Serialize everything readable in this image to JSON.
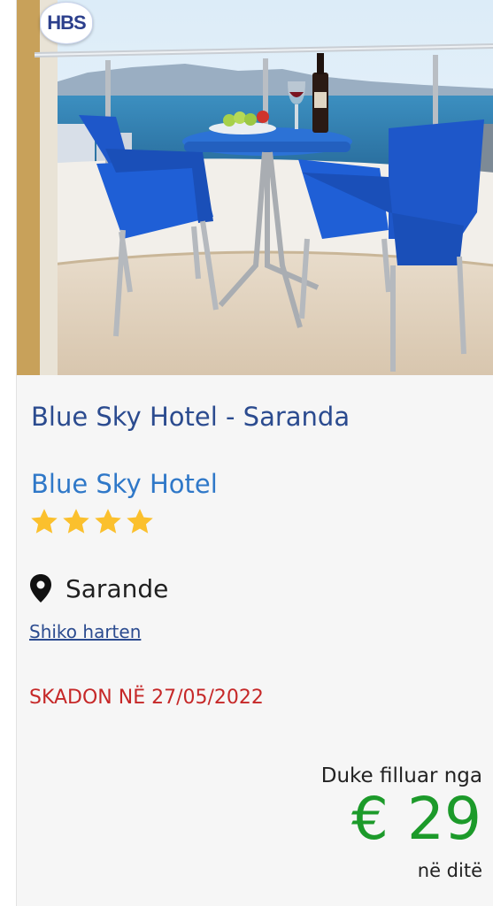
{
  "logo": {
    "text": "HBS"
  },
  "offer": {
    "title": "Blue Sky Hotel - Saranda",
    "hotel_name": "Blue Sky Hotel",
    "stars": 4,
    "location": "Sarande",
    "map_link": "Shiko harten",
    "expiry": "SKADON NË 27/05/2022"
  },
  "price": {
    "label": "Duke filluar nga",
    "currency": "€",
    "amount": "29",
    "display": "€ 29",
    "unit": "në ditë"
  },
  "colors": {
    "title": "#2b4b8f",
    "hotel_name": "#2f78c8",
    "star": "#fbc02d",
    "expiry": "#c62828",
    "price": "#1c9a2a"
  },
  "icons": {
    "location": "map-pin-icon",
    "rating": "star-icon"
  }
}
